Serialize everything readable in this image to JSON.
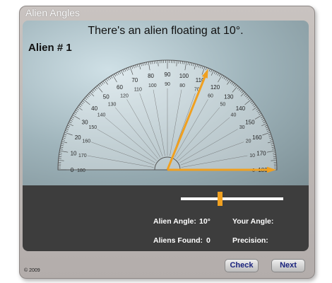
{
  "window": {
    "title": "Alien Angles"
  },
  "scene": {
    "prompt": "There's an alien floating at 10°.",
    "alien_label": "Alien # 1",
    "target_angle_deg": 10,
    "user_angle_deg": 68,
    "arrow_color": "#f0a020"
  },
  "protractor": {
    "outer_labels": [
      0,
      10,
      20,
      30,
      40,
      50,
      60,
      70,
      80,
      90,
      100,
      110,
      120,
      130,
      140,
      150,
      160,
      170,
      180
    ],
    "inner_labels": [
      180,
      170,
      160,
      150,
      140,
      130,
      120,
      110,
      100,
      90,
      80,
      70,
      60,
      50,
      40,
      30,
      20,
      10,
      0
    ]
  },
  "slider": {
    "value_fraction": 0.38,
    "thumb_color": "#f0a020"
  },
  "stats": {
    "alien_angle_label": "Alien Angle:",
    "alien_angle_value": "10°",
    "your_angle_label": "Your Angle:",
    "your_angle_value": "",
    "aliens_found_label": "Aliens Found:",
    "aliens_found_value": "0",
    "precision_label": "Precision:",
    "precision_value": ""
  },
  "buttons": {
    "check": "Check",
    "next": "Next"
  },
  "footer": {
    "copyright": "© 2009"
  }
}
